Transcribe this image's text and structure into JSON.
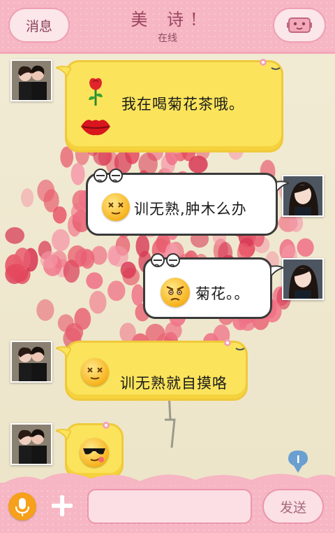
{
  "header": {
    "back_label": "消息",
    "contact_name": "美 诗!",
    "status": "在线",
    "menu_icon": "robot-face-icon"
  },
  "messages": [
    {
      "side": "left",
      "text": "我在喝菊花茶哦。",
      "stickers": [
        "rose-icon",
        "lips-icon"
      ]
    },
    {
      "side": "right",
      "text": "训无熟,肿木么办",
      "emoji": "dizzy-eyes-emoji"
    },
    {
      "side": "right",
      "text": "菊花。。",
      "emoji": "angry-face-emoji"
    },
    {
      "side": "left",
      "text": "训无熟就自摸咯",
      "emoji": "dizzy-eyes-emoji"
    },
    {
      "side": "left",
      "text": "",
      "emoji": "sunglasses-emoji"
    }
  ],
  "composer": {
    "send_label": "发送",
    "input_value": ""
  },
  "colors": {
    "header_pink": "#f6b6c3",
    "bubble_yellow": "#fbe45c",
    "bubble_white": "#ffffff",
    "mic_orange": "#f6a01b"
  }
}
